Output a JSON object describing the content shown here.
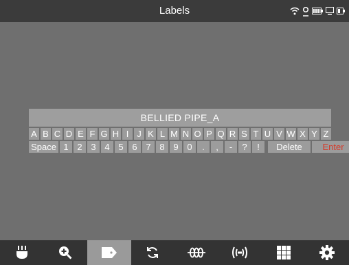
{
  "header": {
    "title": "Labels"
  },
  "status_icons": [
    "wifi-icon",
    "location-pin-icon",
    "battery-icon",
    "display-icon",
    "power-indicator-icon"
  ],
  "label": {
    "text": "BELLIED PIPE_A"
  },
  "keyboard": {
    "letters": [
      "A",
      "B",
      "C",
      "D",
      "E",
      "F",
      "G",
      "H",
      "I",
      "J",
      "K",
      "L",
      "M",
      "N",
      "O",
      "P",
      "Q",
      "R",
      "S",
      "T",
      "U",
      "V",
      "W",
      "X",
      "Y",
      "Z"
    ],
    "space_label": "Space",
    "symbols": [
      "1",
      "2",
      "3",
      "4",
      "5",
      "6",
      "7",
      "8",
      "9",
      "0",
      ".",
      ",",
      "-",
      "?",
      "!"
    ],
    "delete_label": "Delete",
    "enter_label": "Enter",
    "enter_color": "#d63a2a"
  },
  "bottom_nav": {
    "active_index": 2,
    "items": [
      {
        "icon": "lamp-icon"
      },
      {
        "icon": "zoom-in-icon"
      },
      {
        "icon": "label-tag-icon"
      },
      {
        "icon": "rotate-icon"
      },
      {
        "icon": "sonde-icon"
      },
      {
        "icon": "transmitter-icon"
      },
      {
        "icon": "grid-icon"
      },
      {
        "icon": "settings-gear-icon"
      }
    ]
  },
  "colors": {
    "header_bg": "#3b3b3b",
    "body_bg": "#6f6f6f",
    "key_bg": "#9c9c9c",
    "active_tab_bg": "#9a9a9a"
  }
}
